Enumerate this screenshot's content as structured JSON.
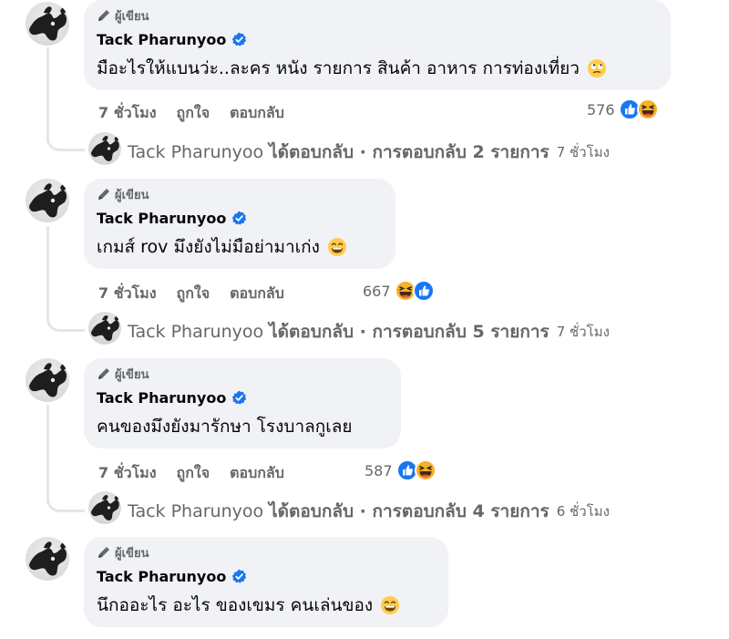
{
  "comments": [
    {
      "badge": "ผู้เขียน",
      "author": "Tack Pharunyoo",
      "text": "มือะไรให้แบนว่ะ..ละคร หนัง รายการ สินค้า อาหาร การท่องเที่ยว",
      "emoji": "rolling-eyes-emoji",
      "time": "7 ชั่วโมง",
      "like_label": "ถูกใจ",
      "reply_label": "ตอบกลับ",
      "reaction_count": "576",
      "reactions": [
        "like",
        "haha"
      ],
      "reply_author": "Tack Pharunyoo",
      "reply_summary": "ได้ตอบกลับ · การตอบกลับ 2 รายการ",
      "reply_time": "7 ชั่วโมง"
    },
    {
      "badge": "ผู้เขียน",
      "author": "Tack Pharunyoo",
      "text": "เกมส์ rov มึงยังไม่มือย่ามาเก่ง",
      "emoji": "grinning-emoji",
      "time": "7 ชั่วโมง",
      "like_label": "ถูกใจ",
      "reply_label": "ตอบกลับ",
      "reaction_count": "667",
      "reactions": [
        "haha",
        "like"
      ],
      "reply_author": "Tack Pharunyoo",
      "reply_summary": "ได้ตอบกลับ · การตอบกลับ 5 รายการ",
      "reply_time": "7 ชั่วโมง"
    },
    {
      "badge": "ผู้เขียน",
      "author": "Tack Pharunyoo",
      "text": "คนของมึงยังมารักษา โรงบาลกูเลย",
      "emoji": "",
      "time": "7 ชั่วโมง",
      "like_label": "ถูกใจ",
      "reply_label": "ตอบกลับ",
      "reaction_count": "587",
      "reactions": [
        "like",
        "haha"
      ],
      "reply_author": "Tack Pharunyoo",
      "reply_summary": "ได้ตอบกลับ · การตอบกลับ 4 รายการ",
      "reply_time": "6 ชั่วโมง"
    },
    {
      "badge": "ผู้เขียน",
      "author": "Tack Pharunyoo",
      "text": "นึกออะไร อะไร ของเขมร คนเล่นของ",
      "emoji": "grinning-emoji",
      "time": "",
      "like_label": "",
      "reply_label": "",
      "reaction_count": "",
      "reactions": [],
      "reply_author": "",
      "reply_summary": "",
      "reply_time": ""
    }
  ],
  "colors": {
    "bubble": "#f0f2f5",
    "secondary_text": "#65676b",
    "verified_blue": "#1877f2",
    "like_blue": "#1877f2",
    "haha_yellow": "#f7b125"
  }
}
